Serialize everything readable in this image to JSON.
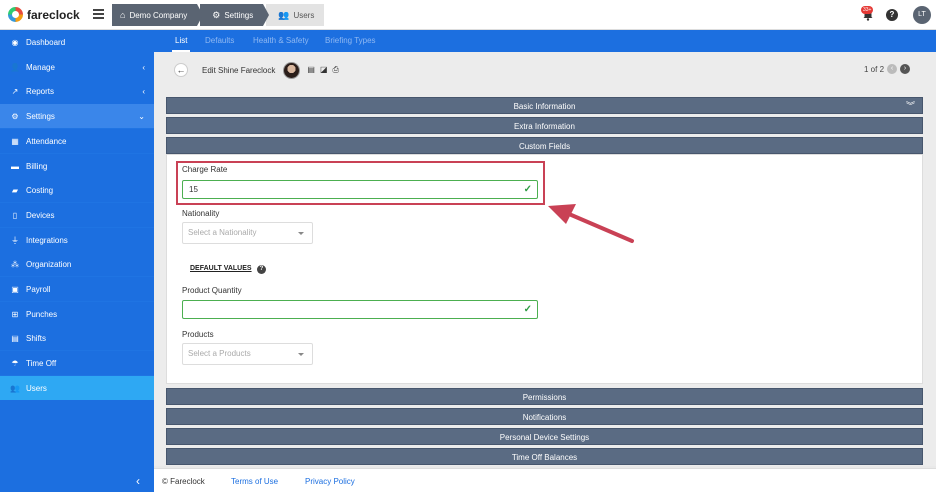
{
  "app": {
    "name": "fareclock"
  },
  "breadcrumb": [
    "Demo Company",
    "Settings",
    "Users"
  ],
  "topbar": {
    "notification_count": "33+",
    "help": "?",
    "user_initials": "LT"
  },
  "sidebar": {
    "items": [
      {
        "label": "Dashboard",
        "icon": "gauge-icon"
      },
      {
        "label": "Manage",
        "icon": "user-icon"
      },
      {
        "label": "Reports",
        "icon": "chart-icon"
      },
      {
        "label": "Settings",
        "icon": "gear-icon"
      },
      {
        "label": "Attendance",
        "icon": "attendance-icon"
      },
      {
        "label": "Billing",
        "icon": "card-icon"
      },
      {
        "label": "Costing",
        "icon": "folder-icon"
      },
      {
        "label": "Devices",
        "icon": "tablet-icon"
      },
      {
        "label": "Integrations",
        "icon": "plug-icon"
      },
      {
        "label": "Organization",
        "icon": "sitemap-icon"
      },
      {
        "label": "Payroll",
        "icon": "money-icon"
      },
      {
        "label": "Punches",
        "icon": "punch-icon"
      },
      {
        "label": "Shifts",
        "icon": "calendar-icon"
      },
      {
        "label": "Time Off",
        "icon": "umbrella-icon"
      },
      {
        "label": "Users",
        "icon": "users-icon"
      }
    ],
    "active": "Users"
  },
  "tabs": [
    "List",
    "Defaults",
    "Health & Safety",
    "Briefing Types"
  ],
  "header": {
    "title": "Edit Shine Fareclock",
    "pager": "1 of 2"
  },
  "sections_top": [
    "Basic Information",
    "Extra Information",
    "Custom Fields"
  ],
  "custom_fields": {
    "charge_rate": {
      "label": "Charge Rate",
      "value": "15"
    },
    "nationality": {
      "label": "Nationality",
      "placeholder": "Select a Nationality"
    },
    "default_values": "DEFAULT VALUES",
    "product_quantity": {
      "label": "Product Quantity",
      "value": ""
    },
    "products": {
      "label": "Products",
      "placeholder": "Select a Products"
    }
  },
  "sections_bottom": [
    "Permissions",
    "Notifications",
    "Personal Device Settings",
    "Time Off Balances"
  ],
  "footer": {
    "copyright": "© Fareclock",
    "terms": "Terms of Use",
    "privacy": "Privacy Policy"
  },
  "colors": {
    "sidebar": "#1c6fe0",
    "active": "#2ea8f3",
    "section_bar": "#5a6b83",
    "highlight": "#c94155",
    "valid": "#4caf50"
  }
}
